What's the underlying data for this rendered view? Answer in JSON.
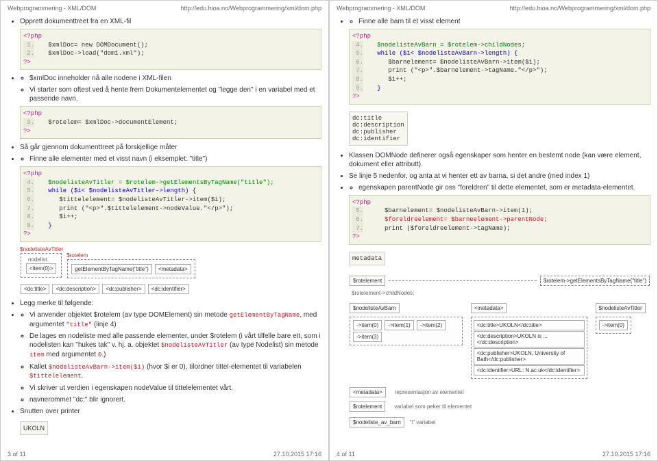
{
  "header": {
    "title": "Webprogrammering - XML/DOM",
    "url": "http://edu.hioa.no/Webprogrammering/xml/dom.php"
  },
  "footer_left": {
    "page": "3 of 11",
    "time": "27.10.2015 17:16"
  },
  "footer_right": {
    "page": "4 of 11",
    "time": "27.10.2015 17:16"
  },
  "left": {
    "b1": "Opprett dokumenttreet fra en XML-fil",
    "code1_open": "<?php",
    "code1_l1": "   $xmlDoc= new DOMDocument();",
    "code1_l2": "   $xmlDoc->load(\"dom1.xml\");",
    "code1_close": "?>",
    "sub1": "$xmlDoc inneholder nå alle nodene i XML-filen",
    "sub2": "Vi starter som oftest ved å hente frem Dokumentelementet og \"legge den\" i en variabel med et passende navn.",
    "code2_open": "<?php",
    "code2_l3": "   $rotelem= $xmlDoc->documentElement;",
    "code2_close": "?>",
    "b2": "Så går gjennom dokumenttreet på forskjellige måter",
    "b3": "Finne alle elementer med et visst navn (i eksemplet: \"title\")",
    "code3_open": "<?php",
    "code3_l4": "   $nodelisteAvTitler = $rotelem->getElementsByTagName(\"title\");",
    "code3_l5": "   while ($i< $nodelisteAvTitler->length) {",
    "code3_l6": "      $tittelelement= $nodelisteAvTitler->item($i);",
    "code3_l7": "      print (\"<p>\".$tittelelement->nodeValue.\"</p>\");",
    "code3_l8": "      $i++;",
    "code3_l9": "   }",
    "code3_close": "?>",
    "fig_nodelist": "$nodelisteAvTitler",
    "fig_nodelist_sub": "nodelist",
    "fig_rotelem": "$rotelem",
    "fig_item0": "<item(0)>",
    "fig_getby": "getElementByTagName(\"title\")",
    "fig_metadata": "<metadata>",
    "fig_dcboxes": [
      "<dc:title>",
      "<dc:description>",
      "<dc:publisher>",
      "<dc:identifier>"
    ],
    "legg": "Legg merke til følgende:",
    "legg1a": "Vi anvender objektet $rotelem (av type DOMElement) sin metode",
    "legg1b": "getElementByTagName",
    "legg1c": ", med argumentet",
    "legg1d": "\"title\"",
    "legg1e": "(linje 4)",
    "legg2a": "De lages en nodeliste med alle passende elementer, under $rotelem (i vårt tilfelle bare ett, som i nodelisten kan \"hukes tak\" v. hj. a. objektet",
    "legg2b": "$nodelisteAvTitler",
    "legg2c": "(av type Nodelist) sin metode",
    "legg2d": "item",
    "legg2e": "med argumentet",
    "legg2f": "0",
    "legg2g": ".)",
    "legg3a": "Kallet",
    "legg3b": "$nodelisteAvBarn->item($i)",
    "legg3c": "(hvor $i er 0), tilordner tittel-elementet til variabelen",
    "legg3d": "$tittelelement",
    "legg4": "Vi skriver ut verdien i egenskapen nodeValue til tittelelementet vårt.",
    "legg5": "navnerommet \"dc:\" blir ignorert.",
    "snutten": "Snutten over printer",
    "ukoln": "UKOLN"
  },
  "right": {
    "b1": "Finne alle barn til et visst element",
    "code1_open": "<?php",
    "code1_l4": "   $nodelisteAvBarn = $rotelem->childNodes;",
    "code1_l5": "   while ($i< $nodelisteAvBarn->length) {",
    "code1_l6": "      $barnelement= $nodelisteAvBarn->item($i);",
    "code1_l7": "      print (\"<p>\".$barnelement->tagName.\"</p>\");",
    "code1_l8": "      $i++;",
    "code1_l9": "   }",
    "code1_close": "?>",
    "tags1": "dc:title\ndc:description\ndc:publisher\ndc:identifier",
    "b2": "Klassen DOMNode definerer også egenskaper som henter en bestemt node (kan være element, dokument eller attributt).",
    "b3": "Se linje 5 nedenfor, og anta at vi henter ett av barna, si det andre (med index 1)",
    "b4": "egenskapen parentNode gir oss \"foreldren\" til dette elementet, som er metadata-elementet.",
    "code2_open": "<?php",
    "code2_l5": "     $barnelement= $nodelisteAvBarn->item(1);",
    "code2_l6": "     $foreldreelement= $barneelement->parentNode;",
    "code2_l7": "     print ($foreldreelement->tagName);",
    "code2_close": "?>",
    "metadata_out": "metadata",
    "fig_rotelement": "$rotelement",
    "fig_getby2": "$rotelem->getElementsByTagName(\"title\")",
    "fig_childnodes": "$rotelement->childNodes;",
    "fig_nodelisteAvBarn": "$nodelisteAvBarn",
    "fig_nodelisteAvTitler": "$nodelisteAvTitler",
    "fig_metadata2": "<metadata>",
    "fig_items": [
      "->item(0)",
      "->item(1)",
      "->item(2)",
      "->item(3)"
    ],
    "fig_item0b": "->item(0)",
    "fig_rowsbox": [
      "<dc:title>UKOLN</dc:title>",
      "<dc:description>UKOLN is ...</dc:description>",
      "<dc:publisher>UKOLN, University of Bath</dc:publisher>",
      "<dc:identifier>URL: N.ac.uk</dc:identifier>"
    ],
    "fig_meta_small": "<metadata>",
    "fig_rotelem_small": "$rotelement",
    "fig_note1": "representasjon av elementet",
    "fig_note2": "variabel som peker til elementet",
    "fig_nodeliste_av_barn": "$nodeliste_av_barn",
    "fig_in_var": "\"i\" variabel"
  }
}
